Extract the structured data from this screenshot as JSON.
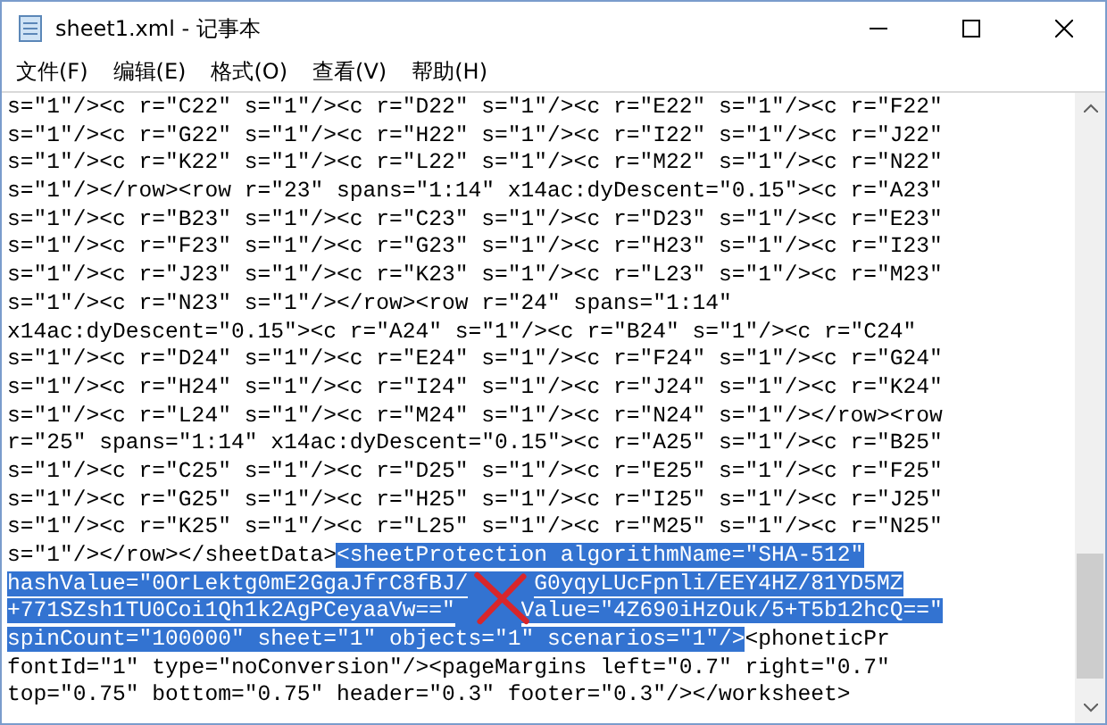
{
  "window": {
    "title": "sheet1.xml - 记事本"
  },
  "menu": [
    "文件(F)",
    "编辑(E)",
    "格式(O)",
    "查看(V)",
    "帮助(H)"
  ],
  "lines": [
    {
      "segments": [
        {
          "kind": "text",
          "text": "s=\"1\"/><c r=\"C22\" s=\"1\"/><c r=\"D22\" s=\"1\"/><c r=\"E22\" s=\"1\"/><c r=\"F22\"",
          "selected": false
        }
      ]
    },
    {
      "segments": [
        {
          "kind": "text",
          "text": "s=\"1\"/><c r=\"G22\" s=\"1\"/><c r=\"H22\" s=\"1\"/><c r=\"I22\" s=\"1\"/><c r=\"J22\"",
          "selected": false
        }
      ]
    },
    {
      "segments": [
        {
          "kind": "text",
          "text": "s=\"1\"/><c r=\"K22\" s=\"1\"/><c r=\"L22\" s=\"1\"/><c r=\"M22\" s=\"1\"/><c r=\"N22\"",
          "selected": false
        }
      ]
    },
    {
      "segments": [
        {
          "kind": "text",
          "text": "s=\"1\"/></row><row r=\"23\" spans=\"1:14\" x14ac:dyDescent=\"0.15\"><c r=\"A23\"",
          "selected": false
        }
      ]
    },
    {
      "segments": [
        {
          "kind": "text",
          "text": "s=\"1\"/><c r=\"B23\" s=\"1\"/><c r=\"C23\" s=\"1\"/><c r=\"D23\" s=\"1\"/><c r=\"E23\"",
          "selected": false
        }
      ]
    },
    {
      "segments": [
        {
          "kind": "text",
          "text": "s=\"1\"/><c r=\"F23\" s=\"1\"/><c r=\"G23\" s=\"1\"/><c r=\"H23\" s=\"1\"/><c r=\"I23\"",
          "selected": false
        }
      ]
    },
    {
      "segments": [
        {
          "kind": "text",
          "text": "s=\"1\"/><c r=\"J23\" s=\"1\"/><c r=\"K23\" s=\"1\"/><c r=\"L23\" s=\"1\"/><c r=\"M23\"",
          "selected": false
        }
      ]
    },
    {
      "segments": [
        {
          "kind": "text",
          "text": "s=\"1\"/><c r=\"N23\" s=\"1\"/></row><row r=\"24\" spans=\"1:14\"",
          "selected": false
        }
      ]
    },
    {
      "segments": [
        {
          "kind": "text",
          "text": "x14ac:dyDescent=\"0.15\"><c r=\"A24\" s=\"1\"/><c r=\"B24\" s=\"1\"/><c r=\"C24\"",
          "selected": false
        }
      ]
    },
    {
      "segments": [
        {
          "kind": "text",
          "text": "s=\"1\"/><c r=\"D24\" s=\"1\"/><c r=\"E24\" s=\"1\"/><c r=\"F24\" s=\"1\"/><c r=\"G24\"",
          "selected": false
        }
      ]
    },
    {
      "segments": [
        {
          "kind": "text",
          "text": "s=\"1\"/><c r=\"H24\" s=\"1\"/><c r=\"I24\" s=\"1\"/><c r=\"J24\" s=\"1\"/><c r=\"K24\"",
          "selected": false
        }
      ]
    },
    {
      "segments": [
        {
          "kind": "text",
          "text": "s=\"1\"/><c r=\"L24\" s=\"1\"/><c r=\"M24\" s=\"1\"/><c r=\"N24\" s=\"1\"/></row><row",
          "selected": false
        }
      ]
    },
    {
      "segments": [
        {
          "kind": "text",
          "text": "r=\"25\" spans=\"1:14\" x14ac:dyDescent=\"0.15\"><c r=\"A25\" s=\"1\"/><c r=\"B25\"",
          "selected": false
        }
      ]
    },
    {
      "segments": [
        {
          "kind": "text",
          "text": "s=\"1\"/><c r=\"C25\" s=\"1\"/><c r=\"D25\" s=\"1\"/><c r=\"E25\" s=\"1\"/><c r=\"F25\"",
          "selected": false
        }
      ]
    },
    {
      "segments": [
        {
          "kind": "text",
          "text": "s=\"1\"/><c r=\"G25\" s=\"1\"/><c r=\"H25\" s=\"1\"/><c r=\"I25\" s=\"1\"/><c r=\"J25\"",
          "selected": false
        }
      ]
    },
    {
      "segments": [
        {
          "kind": "text",
          "text": "s=\"1\"/><c r=\"K25\" s=\"1\"/><c r=\"L25\" s=\"1\"/><c r=\"M25\" s=\"1\"/><c r=\"N25\"",
          "selected": false
        }
      ]
    },
    {
      "segments": [
        {
          "kind": "text",
          "text": "s=\"1\"/></row></sheetData>",
          "selected": false
        },
        {
          "kind": "text",
          "text": "<sheetProtection algorithmName=\"SHA-512\"",
          "selected": true
        }
      ]
    },
    {
      "segments": [
        {
          "kind": "text",
          "text": "hashValue=\"0OrLektg0mE2GgaJfrC8fBJ/",
          "selected": true
        },
        {
          "kind": "cross",
          "selected": true
        },
        {
          "kind": "text",
          "text": "G0yqyLUcFpnli/EEY4HZ/81YD5MZ",
          "selected": true
        }
      ]
    },
    {
      "segments": [
        {
          "kind": "text",
          "text": "+771SZsh1TU0Coi1Qh1k2AgPCeyaaVw==\"",
          "selected": true
        },
        {
          "kind": "covered",
          "selected": true
        },
        {
          "kind": "text",
          "text": "Value=\"4Z690iHzOuk/5+T5b12hcQ==\"",
          "selected": true
        }
      ]
    },
    {
      "segments": [
        {
          "kind": "text",
          "text": "spinCount=\"100000\" sheet=\"1\" objects=\"1\" scenarios=\"1\"/>",
          "selected": true
        },
        {
          "kind": "text",
          "text": "<phoneticPr",
          "selected": false
        }
      ]
    },
    {
      "segments": [
        {
          "kind": "text",
          "text": "fontId=\"1\" type=\"noConversion\"/><pageMargins left=\"0.7\" right=\"0.7\"",
          "selected": false
        }
      ]
    },
    {
      "segments": [
        {
          "kind": "text",
          "text": "top=\"0.75\" bottom=\"0.75\" header=\"0.3\" footer=\"0.3\"/></worksheet>",
          "selected": false
        }
      ]
    }
  ]
}
